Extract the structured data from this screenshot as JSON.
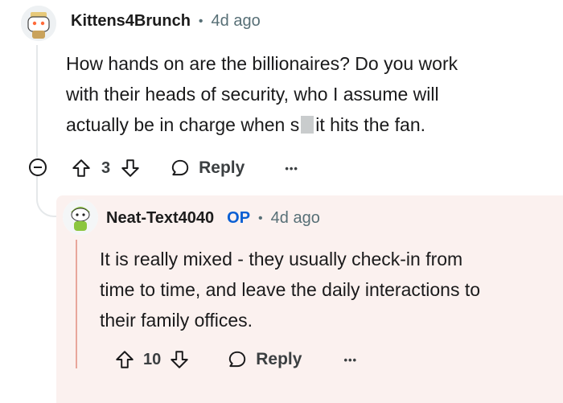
{
  "comment": {
    "username": "Kittens4Brunch",
    "separator": "•",
    "time": "4d ago",
    "body_lines": [
      "How hands on are the billionaires? Do you work",
      "with their heads of security, who I assume will"
    ],
    "body_line3_before": "actually be in charge when s",
    "body_line3_after": "it hits the fan.",
    "upvotes": "3",
    "reply_label": "Reply",
    "more_label": "•••"
  },
  "reply": {
    "username": "Neat-Text4040",
    "badge": "OP",
    "separator": "•",
    "time": "4d ago",
    "body_lines": [
      "It is really mixed - they usually check-in from",
      "time to time, and leave the daily interactions to",
      "their family offices."
    ],
    "upvotes": "10",
    "reply_label": "Reply",
    "more_label": "•••"
  },
  "colors": {
    "reply_background": "#fbf1ef",
    "op_badge": "#0a5fd3",
    "thread_line": "#e5e8ea",
    "reply_indicator": "#e8a69b"
  }
}
